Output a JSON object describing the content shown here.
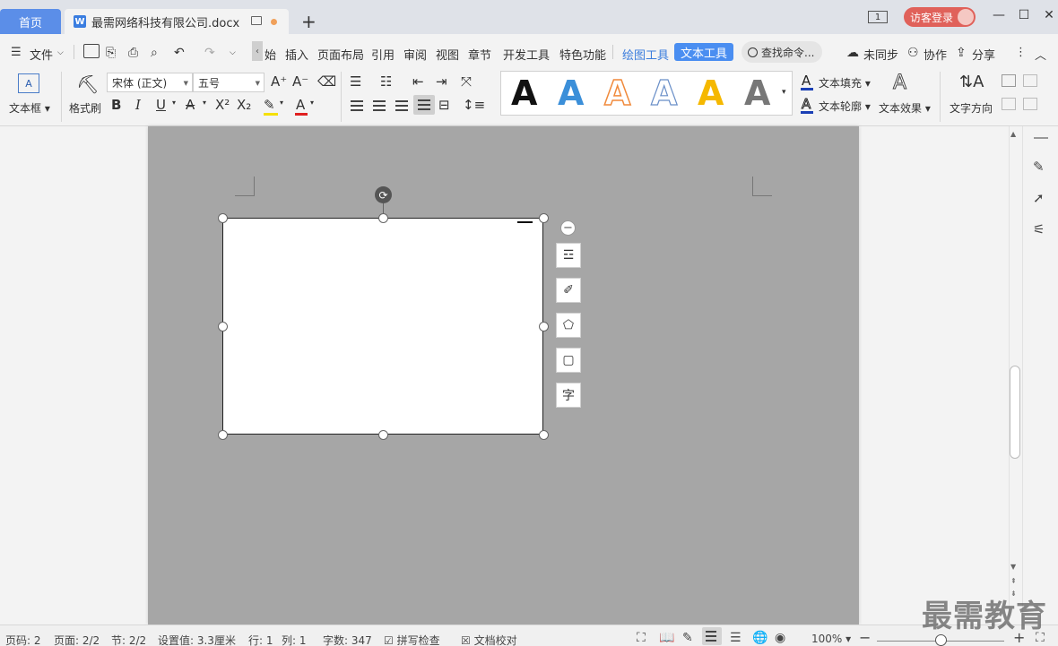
{
  "titlebar": {
    "home_tab": "首页",
    "doc_tab": "最需网络科技有限公司.docx",
    "doc_icon_letter": "W",
    "page_indicator": "1",
    "login": "访客登录"
  },
  "menubar": {
    "file": "文件",
    "items": [
      "始",
      "插入",
      "页面布局",
      "引用",
      "审阅",
      "视图",
      "章节",
      "开发工具",
      "特色功能",
      "绘图工具",
      "文本工具"
    ],
    "search": "查找命令...",
    "sync": "未同步",
    "collab": "协作",
    "share": "分享"
  },
  "ribbon": {
    "textbox_label": "文本框",
    "format_painter": "格式刷",
    "font": "宋体 (正文)",
    "size": "五号",
    "text_fill": "文本填充",
    "text_outline": "文本轮廓",
    "text_effect": "文本效果",
    "text_direction": "文字方向",
    "style_letter": "A",
    "style_colors": [
      "#111111",
      "#3b8fd9",
      "#f08a3c",
      "#ffffff",
      "#f5b800",
      "#777777"
    ]
  },
  "float": {
    "char_btn": "字"
  },
  "statusbar": {
    "page_num": "页码: 2",
    "page": "页面: 2/2",
    "section": "节: 2/2",
    "setting": "设置值: 3.3厘米",
    "row": "行: 1",
    "col": "列: 1",
    "words": "字数: 347",
    "spell": "拼写检查",
    "proof": "文档校对",
    "zoom": "100%",
    "zoom_level": 0.5
  },
  "watermark": "最需教育"
}
